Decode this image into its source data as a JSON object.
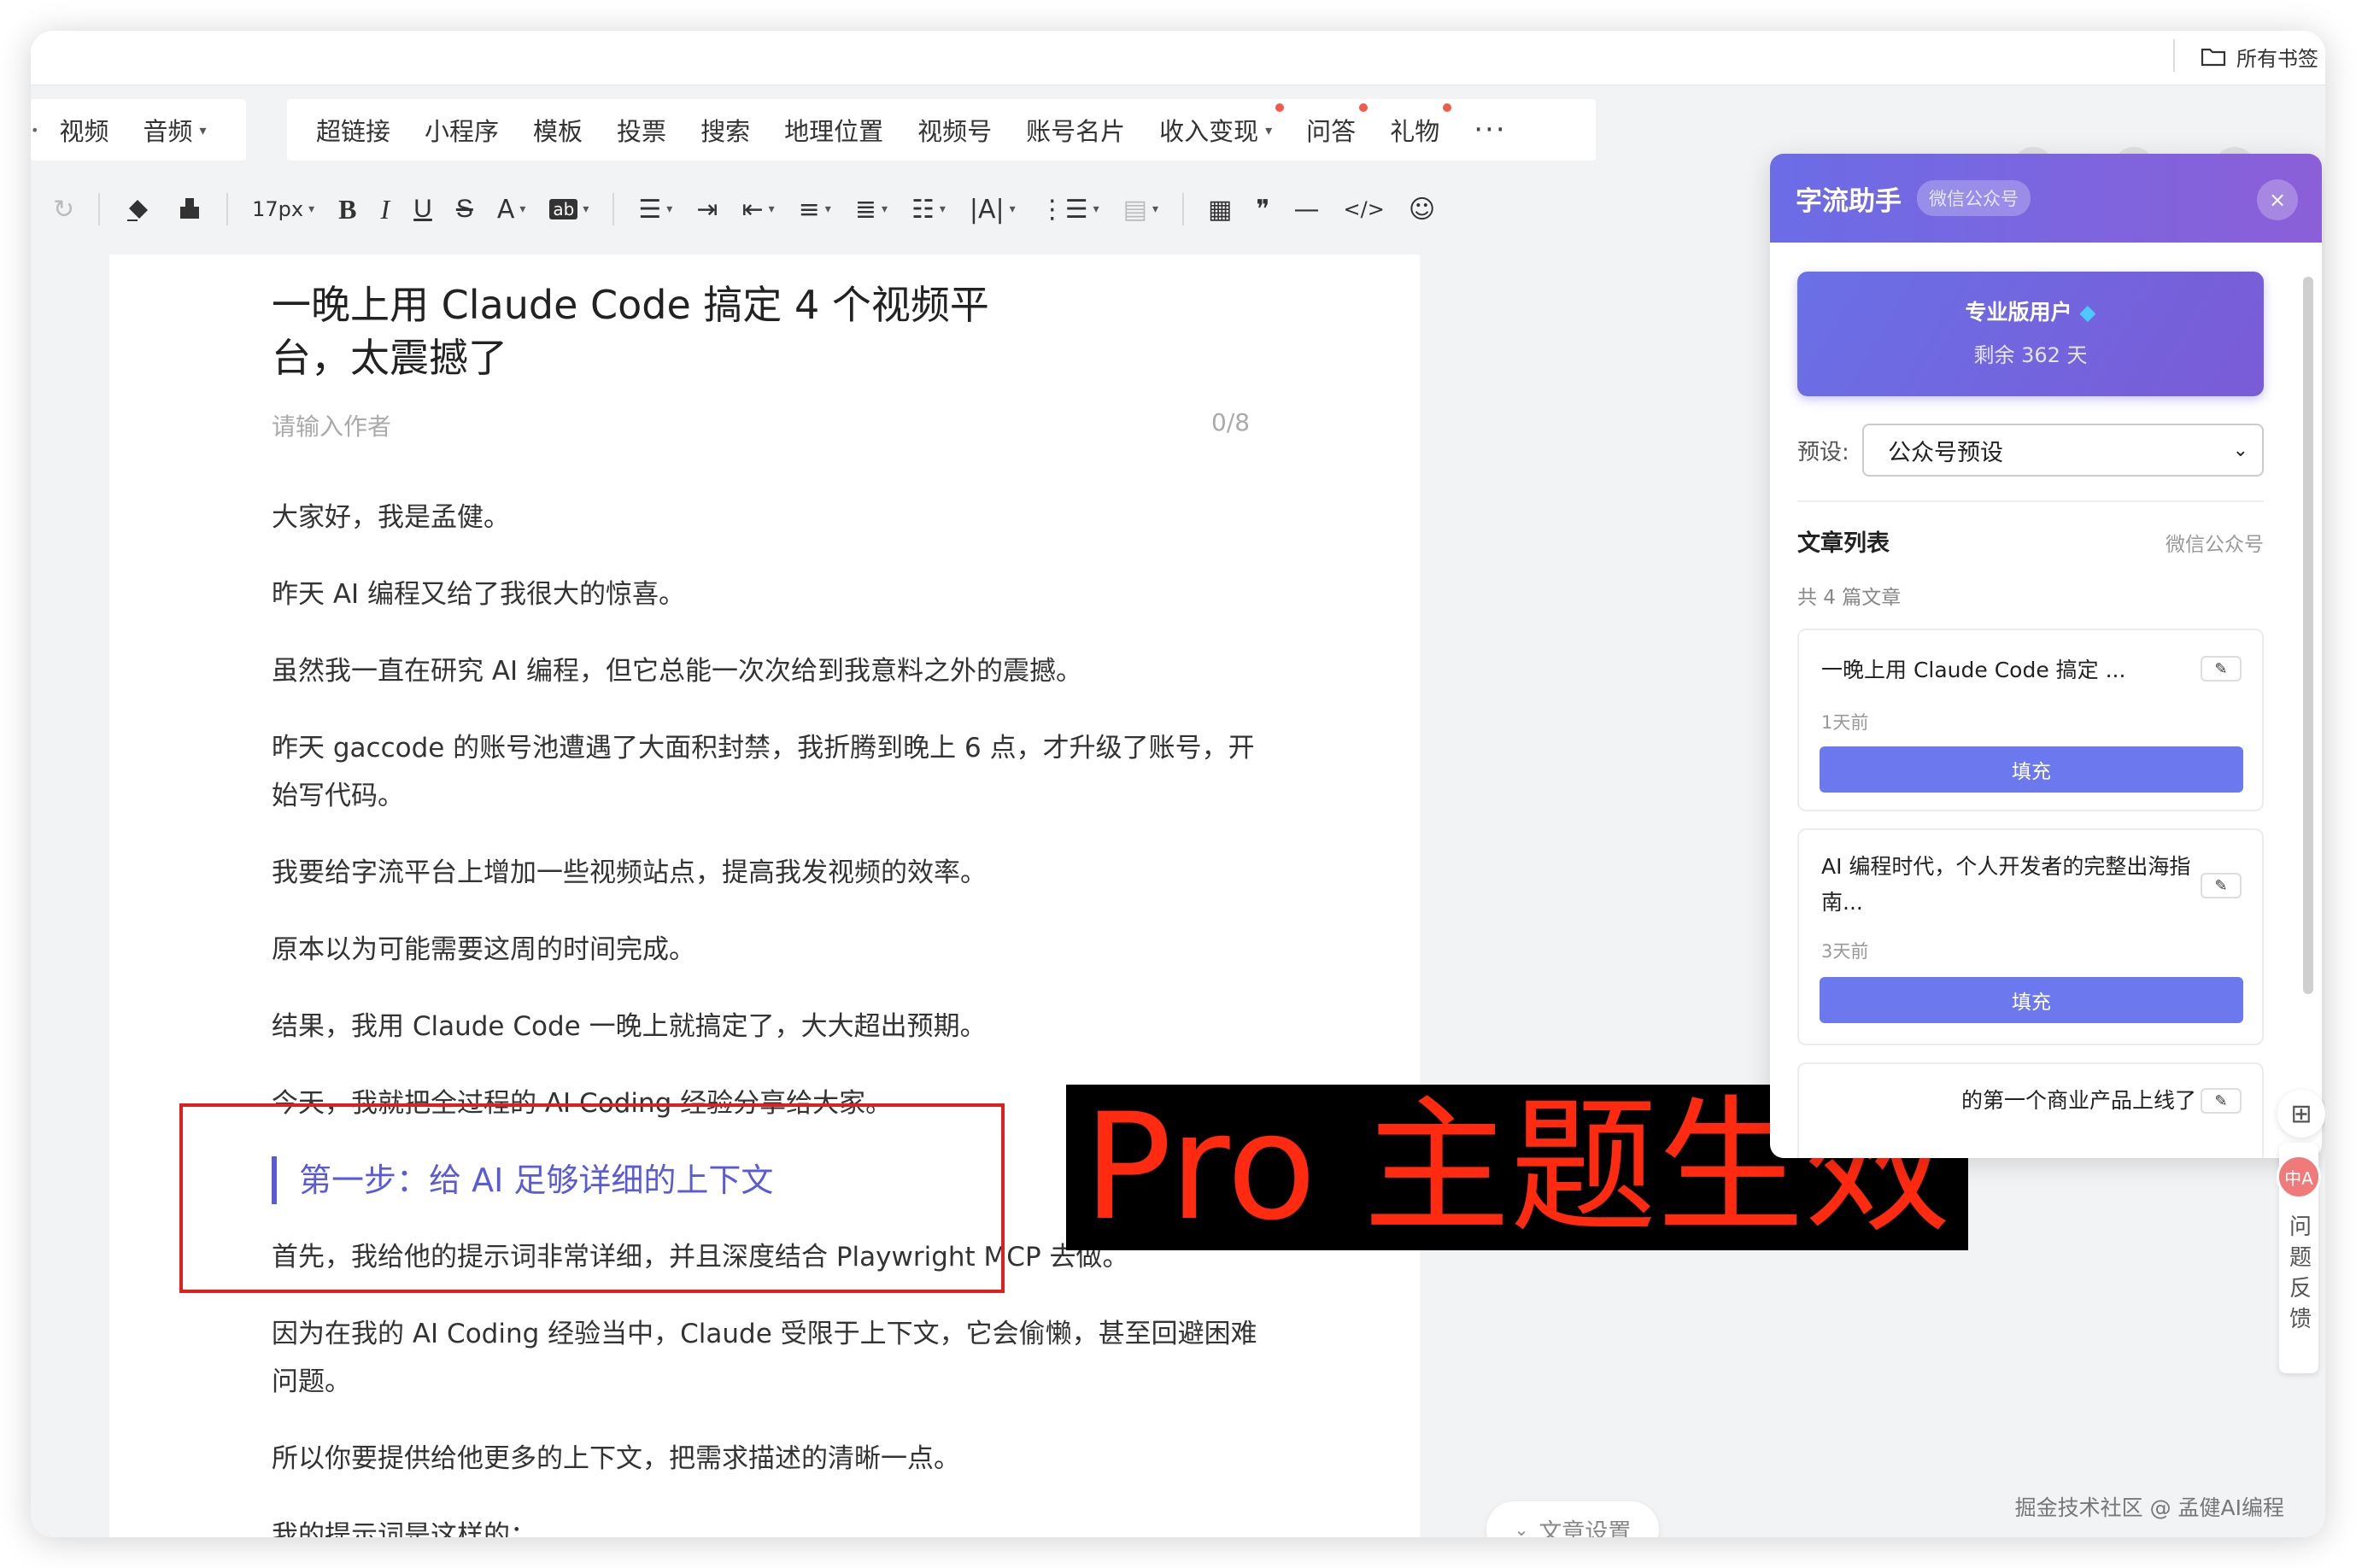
{
  "bookmarks": {
    "all_label": "所有书签"
  },
  "menu": {
    "left_items": [
      "视频",
      "音频"
    ],
    "items": [
      {
        "label": "超链接",
        "caret": false,
        "dot": false
      },
      {
        "label": "小程序",
        "caret": false,
        "dot": false
      },
      {
        "label": "模板",
        "caret": false,
        "dot": false
      },
      {
        "label": "投票",
        "caret": false,
        "dot": false
      },
      {
        "label": "搜索",
        "caret": false,
        "dot": false
      },
      {
        "label": "地理位置",
        "caret": false,
        "dot": false
      },
      {
        "label": "视频号",
        "caret": false,
        "dot": false
      },
      {
        "label": "账号名片",
        "caret": false,
        "dot": false
      },
      {
        "label": "收入变现",
        "caret": true,
        "dot": true
      },
      {
        "label": "问答",
        "caret": false,
        "dot": true
      },
      {
        "label": "礼物",
        "caret": false,
        "dot": true
      }
    ],
    "more": "···"
  },
  "format": {
    "font_size": "17px"
  },
  "article": {
    "title": "一晚上用 Claude Code 搞定 4 个视频平台，太震撼了",
    "author_placeholder": "请输入作者",
    "author_counter": "0/8",
    "paragraphs_1": [
      "大家好，我是孟健。",
      "昨天 AI 编程又给了我很大的惊喜。",
      "虽然我一直在研究 AI 编程，但它总能一次次给到我意料之外的震撼。",
      "昨天 gaccode 的账号池遭遇了大面积封禁，我折腾到晚上 6 点，才升级了账号，开始写代码。",
      "我要给字流平台上增加一些视频站点，提高我发视频的效率。",
      "原本以为可能需要这周的时间完成。",
      "结果，我用 Claude Code 一晚上就搞定了，大大超出预期。",
      "今天，我就把全过程的 AI Coding 经验分享给大家。"
    ],
    "heading": "第一步：给 AI 足够详细的上下文",
    "paragraphs_2": [
      "首先，我给他的提示词非常详细，并且深度结合 Playwright MCP 去做。",
      "因为在我的 AI Coding 经验当中，Claude 受限于上下文，它会偷懒，甚至回避困难问题。",
      "所以你要提供给他更多的上下文，把需求描述的清晰一点。",
      "我的提示词是这样的："
    ]
  },
  "overlay_label": "Pro 主题生效",
  "article_settings": "文章设置",
  "panel": {
    "title": "字流助手",
    "tag": "微信公众号",
    "close": "×",
    "pro_title": "专业版用户",
    "pro_days": "剩余 362 天",
    "preset_label": "预设:",
    "preset_value": "公众号预设",
    "list_title": "文章列表",
    "list_source": "微信公众号",
    "list_count": "共 4 篇文章",
    "articles": [
      {
        "title": "一晚上用 Claude Code 搞定 ...",
        "time": "1天前",
        "button": "填充"
      },
      {
        "title": "AI 编程时代，个人开发者的完整出海指南...",
        "time": "3天前",
        "button": "填充"
      },
      {
        "title": "的第一个商业产品上线了"
      }
    ]
  },
  "feedback": {
    "avatar_text": "中A",
    "label": "问题反馈"
  },
  "watermark": "掘金技术社区 @ 孟健AI编程",
  "colors": {
    "accent": "#5a5bd6",
    "annotation_red": "#e02020",
    "overlay_text": "#ff2a10"
  }
}
